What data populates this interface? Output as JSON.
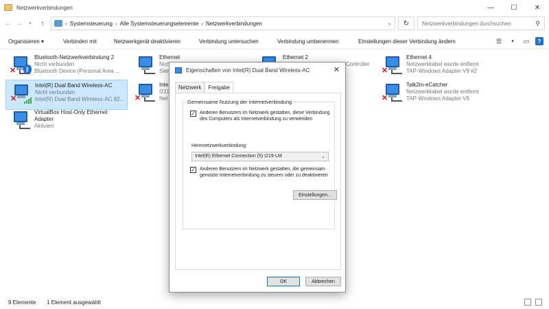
{
  "window": {
    "title": "Netzwerkverbindungen",
    "controls": {
      "minimize": "—",
      "maximize": "☐",
      "close": "✕"
    }
  },
  "address": {
    "crumbs": [
      "Systemsteuerung",
      "Alle Systemsteuerungselemente",
      "Netzwerkverbindungen"
    ],
    "search_placeholder": "Netzwerkverbindungen durchsuchen"
  },
  "commands": {
    "organize": "Organisieren ▾",
    "connect": "Verbinden mit",
    "disable": "Netzwerkgerät deaktivieren",
    "diagnose": "Verbindung untersuchen",
    "rename": "Verbindung umbenennen",
    "settings": "Einstellungen dieser Verbindung ändern"
  },
  "items": [
    {
      "name": "Bluetooth-Netzwerkverbindung 2",
      "status": "Nicht verbunden",
      "device": "Bluetooth Device (Personal Area ..."
    },
    {
      "name": "Intel(R) Dual Band Wireless-AC",
      "status": "Nicht verbunden",
      "device": "Intel(R) Dual Band Wireless-AC 82..."
    },
    {
      "name": "VirtualBox Host-Only Ethernet",
      "status": "Adapter",
      "device": "Aktiviert"
    },
    {
      "name": "Ethernet",
      "status": "Nich",
      "device": "Sien"
    },
    {
      "name": "Inte",
      "status": "I219",
      "device": "Net"
    },
    {
      "name": "Ethernet 2",
      "status": "",
      "device": "Controller"
    },
    {
      "name": "Ethernet 4",
      "status": "Netzwerkkabel wurde entfernt",
      "device": "TAP-Windows Adapter V9 #2"
    },
    {
      "name": "Talk2m-eCatcher",
      "status": "Netzwerkkabel wurde entfernt",
      "device": "TAP-Windows Adapter V9"
    }
  ],
  "status": {
    "count": "9 Elemente",
    "selected": "1 Element ausgewählt"
  },
  "dialog": {
    "title": "Eigenschaften von Intel(R) Dual Band Wireless-AC",
    "tabs": [
      "Netzwerk",
      "Freigabe"
    ],
    "group_label": "Gemeinsame Nutzung der Internetverbindung",
    "check1": "Anderen Benutzern im Netzwerk gestatten, diese Verbindung des Computers als Internetverbindung zu verwenden",
    "home_label": "Heimnetzwerkverbindung:",
    "home_value": "Intel(R) Ethernet Connection (5) I219-LM",
    "check2": "Anderen Benutzern im Netzwerk gestatten, die gemeinsam genutzte Internetverbindung zu steuern oder zu deaktivieren",
    "settings_btn": "Einstellungen...",
    "ok": "OK",
    "cancel": "Abbrechen"
  }
}
